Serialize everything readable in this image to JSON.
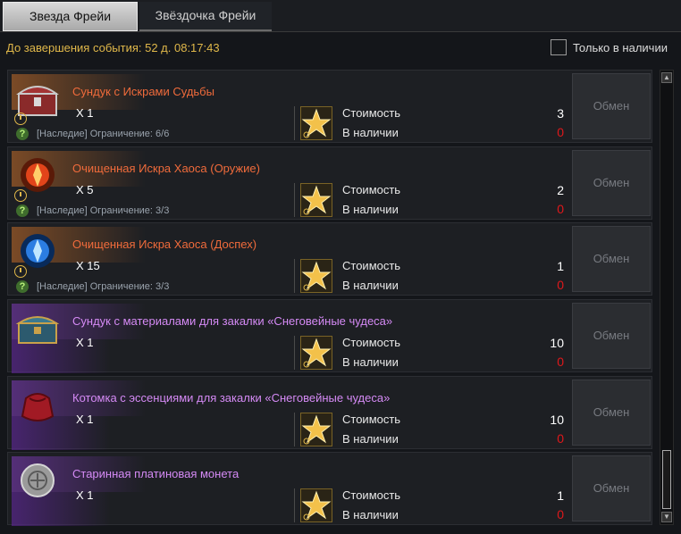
{
  "tabs": [
    {
      "label": "Звезда Фрейи"
    },
    {
      "label": "Звёздочка Фрейи"
    }
  ],
  "header": {
    "timer_text": "До завершения события: 52 д. 08:17:43",
    "filter_label": "Только в наличии"
  },
  "common": {
    "cost_label": "Стоимость",
    "stock_label": "В наличии",
    "exchange_label": "Обмен"
  },
  "items": [
    {
      "name": "Сундук с Искрами Судьбы",
      "rarity": "orange",
      "qty": "X 1",
      "limit": "[Наследие] Ограничение: 6/6",
      "cost": "3",
      "stock": "0",
      "icon": "chest-red-icon"
    },
    {
      "name": "Очищенная Искра Хаоса (Оружие)",
      "rarity": "orange",
      "qty": "X 5",
      "limit": "[Наследие] Ограничение: 3/3",
      "cost": "2",
      "stock": "0",
      "icon": "spark-red-icon"
    },
    {
      "name": "Очищенная Искра Хаоса (Доспех)",
      "rarity": "orange",
      "qty": "X 15",
      "limit": "[Наследие] Ограничение: 3/3",
      "cost": "1",
      "stock": "0",
      "icon": "spark-blue-icon"
    },
    {
      "name": "Сундук с материалами для закалки «Снеговейные чудеса»",
      "rarity": "purple",
      "qty": "X 1",
      "limit": "",
      "cost": "10",
      "stock": "0",
      "icon": "chest-blue-icon"
    },
    {
      "name": "Котомка с эссенциями для закалки «Снеговейные чудеса»",
      "rarity": "purple",
      "qty": "X 1",
      "limit": "",
      "cost": "10",
      "stock": "0",
      "icon": "pouch-red-icon"
    },
    {
      "name": "Старинная платиновая монета",
      "rarity": "purple",
      "qty": "X 1",
      "limit": "",
      "cost": "1",
      "stock": "0",
      "icon": "coin-platinum-icon"
    }
  ],
  "colors": {
    "orange_name": "#f06b3b",
    "purple_name": "#d58af5",
    "stock_zero": "#e0181b",
    "timer": "#e0b84a"
  }
}
